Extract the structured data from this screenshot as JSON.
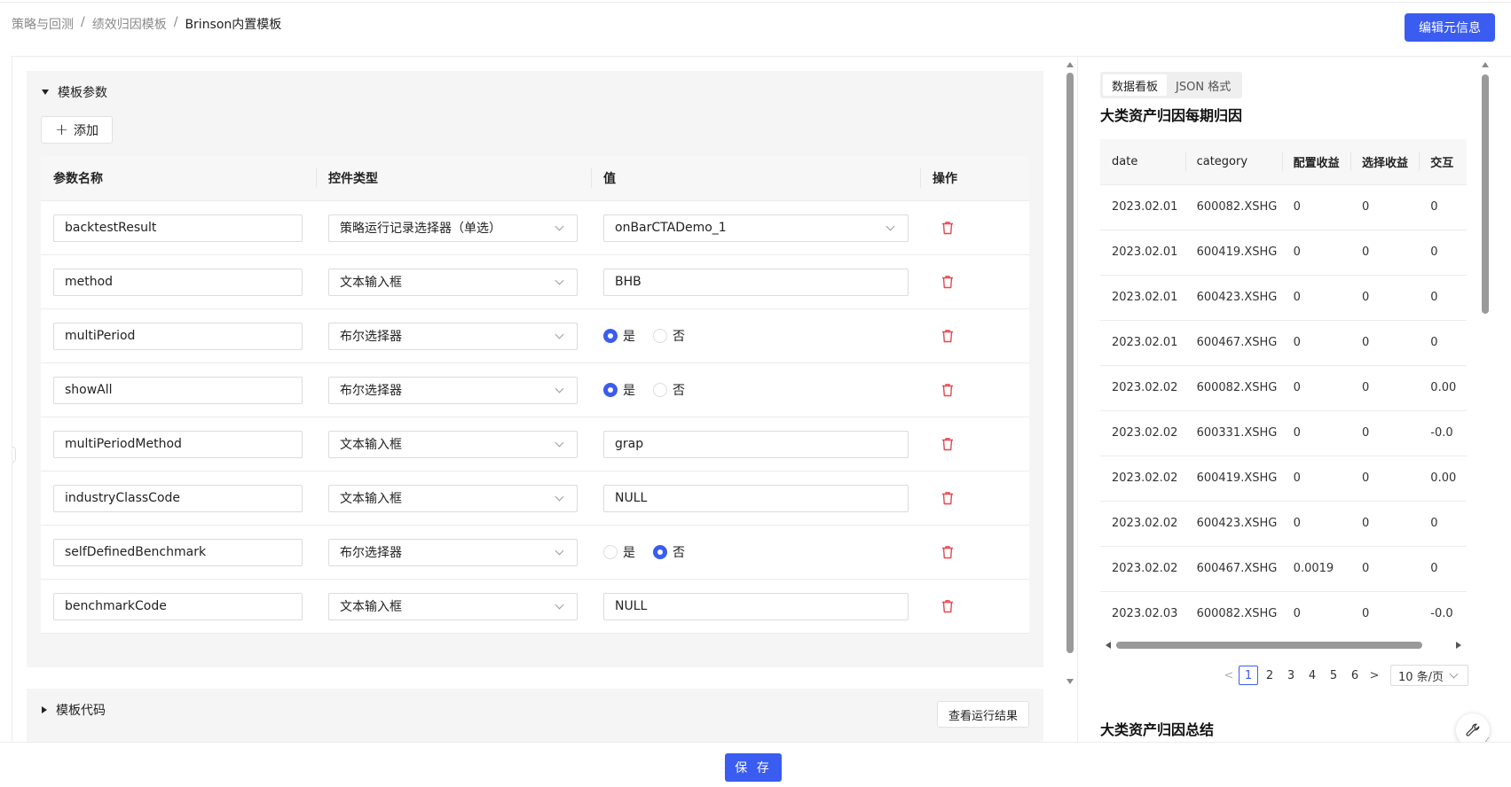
{
  "breadcrumb": {
    "items": [
      "策略与回测",
      "绩效归因模板",
      "Brinson内置模板"
    ],
    "separator": "/"
  },
  "header": {
    "edit_meta_label": "编辑元信息"
  },
  "params_section": {
    "title": "模板参数",
    "add_label": "添加",
    "columns": [
      "参数名称",
      "控件类型",
      "值",
      "操作"
    ],
    "rows": [
      {
        "name": "backtestResult",
        "type": "策略运行记录选择器（单选）",
        "value": "onBarCTADemo_1",
        "kind": "select"
      },
      {
        "name": "method",
        "type": "文本输入框",
        "value": "BHB",
        "kind": "text"
      },
      {
        "name": "multiPeriod",
        "type": "布尔选择器",
        "value": "是",
        "kind": "bool"
      },
      {
        "name": "showAll",
        "type": "布尔选择器",
        "value": "是",
        "kind": "bool"
      },
      {
        "name": "multiPeriodMethod",
        "type": "文本输入框",
        "value": "grap",
        "kind": "text"
      },
      {
        "name": "industryClassCode",
        "type": "文本输入框",
        "value": "NULL",
        "kind": "text"
      },
      {
        "name": "selfDefinedBenchmark",
        "type": "布尔选择器",
        "value": "否",
        "kind": "bool"
      },
      {
        "name": "benchmarkCode",
        "type": "文本输入框",
        "value": "NULL",
        "kind": "text"
      }
    ],
    "bool_options": [
      "是",
      "否"
    ]
  },
  "code_section": {
    "title": "模板代码",
    "view_result_label": "查看运行结果"
  },
  "right": {
    "tabs": [
      {
        "label": "数据看板",
        "active": true
      },
      {
        "label": "JSON 格式",
        "active": false
      }
    ],
    "table_title": "大类资产归因每期归因",
    "table_columns": [
      "date",
      "category",
      "配置收益",
      "选择收益",
      "交互"
    ],
    "table_rows": [
      [
        "2023.02.01",
        "600082.XSHG",
        "0",
        "0",
        "0"
      ],
      [
        "2023.02.01",
        "600419.XSHG",
        "0",
        "0",
        "0"
      ],
      [
        "2023.02.01",
        "600423.XSHG",
        "0",
        "0",
        "0"
      ],
      [
        "2023.02.01",
        "600467.XSHG",
        "0",
        "0",
        "0"
      ],
      [
        "2023.02.02",
        "600082.XSHG",
        "0",
        "0",
        "0.00"
      ],
      [
        "2023.02.02",
        "600331.XSHG",
        "0",
        "0",
        "-0.0"
      ],
      [
        "2023.02.02",
        "600419.XSHG",
        "0",
        "0",
        "0.00"
      ],
      [
        "2023.02.02",
        "600423.XSHG",
        "0",
        "0",
        "0"
      ],
      [
        "2023.02.02",
        "600467.XSHG",
        "0.0019",
        "0",
        "0"
      ],
      [
        "2023.02.03",
        "600082.XSHG",
        "0",
        "0",
        "-0.0"
      ]
    ],
    "pagination": {
      "pages": [
        "1",
        "2",
        "3",
        "4",
        "5",
        "6"
      ],
      "active": "1",
      "prev": "<",
      "next": ">",
      "page_size": "10 条/页"
    },
    "summary_title": "大类资产归因总结"
  },
  "footer": {
    "save_label": "保 存"
  },
  "colors": {
    "primary": "#3b5cf0",
    "danger": "#e5484d",
    "panel_bg": "#f5f5f5"
  },
  "icons": {
    "add": "plus-icon",
    "delete": "trash-icon",
    "tools": "wrench-icon",
    "select": "chevron-down-icon"
  }
}
